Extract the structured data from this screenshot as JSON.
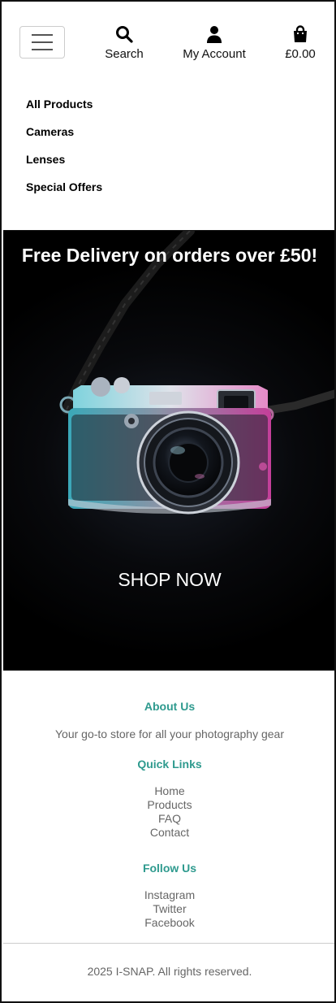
{
  "header": {
    "actions": {
      "search": {
        "label": "Search",
        "icon": "search-icon"
      },
      "account": {
        "label": "My Account",
        "icon": "user-icon"
      },
      "cart": {
        "label": "£0.00",
        "icon": "shopping-bag-icon"
      }
    },
    "menu": [
      "All Products",
      "Cameras",
      "Lenses",
      "Special Offers"
    ]
  },
  "hero": {
    "title": "Free Delivery on orders over £50!",
    "cta": "SHOP NOW"
  },
  "footer": {
    "about": {
      "heading": "About Us",
      "text": "Your go-to store for all your photography gear"
    },
    "quick_links": {
      "heading": "Quick Links",
      "items": [
        "Home",
        "Products",
        "FAQ",
        "Contact"
      ]
    },
    "follow": {
      "heading": "Follow Us",
      "items": [
        "Instagram",
        "Twitter",
        "Facebook"
      ]
    },
    "copyright": "2025 I-SNAP. All rights reserved."
  },
  "colors": {
    "accent": "#2e9a8e",
    "hero_bg": "#000000",
    "muted_text": "#666666"
  }
}
